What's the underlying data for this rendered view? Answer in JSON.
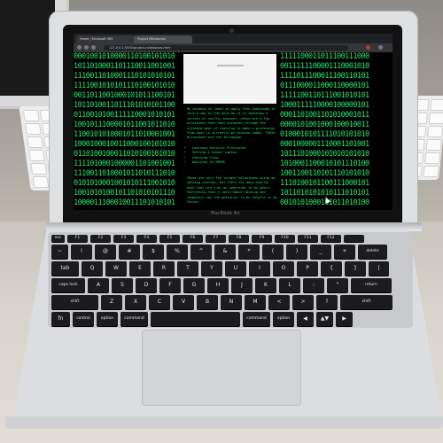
{
  "browser": {
    "tabs": [
      "Home | Microsoft 365",
      "Project Milestones"
    ],
    "url": "127.0.0.1:5500/project-milestones.html"
  },
  "matrix": {
    "left_lines": [
      "0001001010000110100101010",
      "1011010001101110011001001",
      "1110011010001110101010101",
      "1111001010101110100101010",
      "0011011001000101011100101",
      "1011010011011101010101100",
      "0110010100111110001010101",
      "1001011100001011001011010",
      "1100101010001011010001001",
      "1000100010011000100101010",
      "0110100100011010100101010",
      "1111010001000001101001001",
      "1110011010001011010111010",
      "0101010001001010111001010",
      "1001010100101101010101110",
      "1000011100010011101010101"
    ],
    "right_lines": [
      "1111100011011100111000",
      "0011111100001110001010",
      "1111011100011100110101",
      "0111000011000110000101",
      "1111100110111001010101",
      "1000111110000100000101",
      "0001101001101010001011",
      "0000101001000100010011",
      "0100010101111010101010",
      "0001000001110001101001",
      "1011101000101010101010",
      "1010001100010101110100",
      "1001100110101110101010",
      "1110100101100111000101",
      "1011010101010111010101",
      "0010101000101011010100"
    ]
  },
  "article": {
    "intro": "My purpose to learn to apply this knowledge in such a way of the work as it is teaching a variety of skills; however, these are a few milestones that each purposes through the ultimate goal of learning to make a profession from what is currently my hacking hobby. These milestones are the following:",
    "milestones": [
      "Learning Security Principles",
      "Setting a School Laptop",
      "Learning Linux",
      "Applying to SHEMS"
    ],
    "outro": "These are only the largest milestones along my hacking journey, but there are many smaller ones that are just as important to my goals. Everything that I learn about hacking and computers has the potential to be helpful in my future"
  },
  "laptop": {
    "brand": "MacBook Air"
  },
  "keyboard": {
    "row1": [
      "esc",
      "F1",
      "F2",
      "F3",
      "F4",
      "F5",
      "F6",
      "F7",
      "F8",
      "F9",
      "F10",
      "F11",
      "F12",
      ""
    ],
    "row2": [
      "~",
      "!",
      "@",
      "#",
      "$",
      "%",
      "^",
      "&",
      "*",
      "(",
      ")",
      "_",
      "+",
      "delete"
    ],
    "row3": [
      "tab",
      "Q",
      "W",
      "E",
      "R",
      "T",
      "Y",
      "U",
      "I",
      "O",
      "P",
      "{",
      "}",
      "|"
    ],
    "row4": [
      "caps lock",
      "A",
      "S",
      "D",
      "F",
      "G",
      "H",
      "J",
      "K",
      "L",
      ":",
      "\"",
      "return"
    ],
    "row5": [
      "shift",
      "Z",
      "X",
      "C",
      "V",
      "B",
      "N",
      "M",
      "<",
      ">",
      "?",
      "shift"
    ],
    "row6": [
      "fn",
      "control",
      "option",
      "command",
      "",
      "command",
      "option",
      "◀",
      "▲▼",
      "▶"
    ]
  }
}
